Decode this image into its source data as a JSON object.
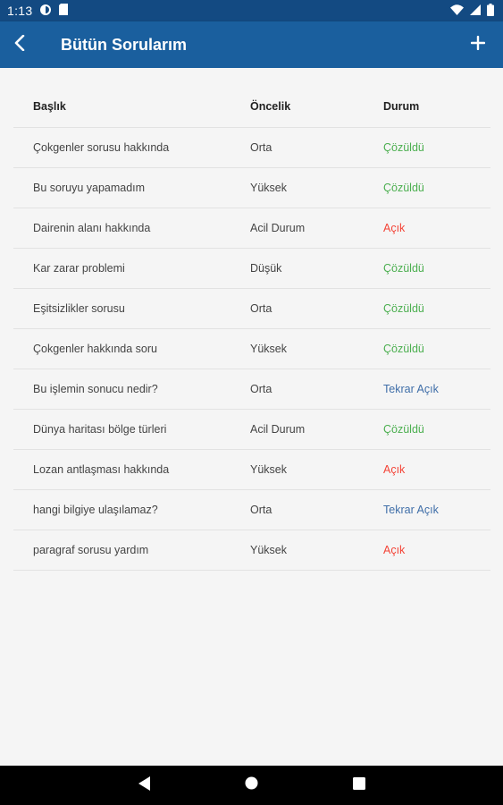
{
  "status_bar": {
    "time": "1:13",
    "icons": [
      "notification-icon",
      "sd-card-icon",
      "wifi-icon",
      "cellular-icon",
      "battery-icon"
    ]
  },
  "app_bar": {
    "title": "Bütün Sorularım",
    "icons": {
      "back": "back-arrow-icon",
      "add": "plus-icon"
    }
  },
  "table": {
    "headers": {
      "title": "Başlık",
      "priority": "Öncelik",
      "status": "Durum"
    },
    "rows": [
      {
        "title": "Çokgenler sorusu hakkında",
        "priority": "Orta",
        "status": "Çözüldü",
        "status_type": "solved"
      },
      {
        "title": "Bu soruyu yapamadım",
        "priority": "Yüksek",
        "status": "Çözüldü",
        "status_type": "solved"
      },
      {
        "title": "Dairenin alanı hakkında",
        "priority": "Acil Durum",
        "status": "Açık",
        "status_type": "open"
      },
      {
        "title": "Kar zarar problemi",
        "priority": "Düşük",
        "status": "Çözüldü",
        "status_type": "solved"
      },
      {
        "title": "Eşitsizlikler sorusu",
        "priority": "Orta",
        "status": "Çözüldü",
        "status_type": "solved"
      },
      {
        "title": "Çokgenler hakkında soru",
        "priority": "Yüksek",
        "status": "Çözüldü",
        "status_type": "solved"
      },
      {
        "title": "Bu işlemin sonucu nedir?",
        "priority": "Orta",
        "status": "Tekrar Açık",
        "status_type": "reopen"
      },
      {
        "title": "Dünya haritası bölge türleri",
        "priority": "Acil Durum",
        "status": "Çözüldü",
        "status_type": "solved"
      },
      {
        "title": "Lozan antlaşması hakkında",
        "priority": "Yüksek",
        "status": "Açık",
        "status_type": "open"
      },
      {
        "title": "hangi bilgiye ulaşılamaz?",
        "priority": "Orta",
        "status": "Tekrar Açık",
        "status_type": "reopen"
      },
      {
        "title": "paragraf sorusu yardım",
        "priority": "Yüksek",
        "status": "Açık",
        "status_type": "open"
      }
    ]
  },
  "colors": {
    "app_bar": "#1a5f9e",
    "status_bar": "#134a82",
    "solved": "#4caf50",
    "open": "#f44336",
    "reopen": "#3f6ea8"
  },
  "nav_bar": {
    "icons": [
      "nav-back-icon",
      "nav-home-icon",
      "nav-recents-icon"
    ]
  }
}
